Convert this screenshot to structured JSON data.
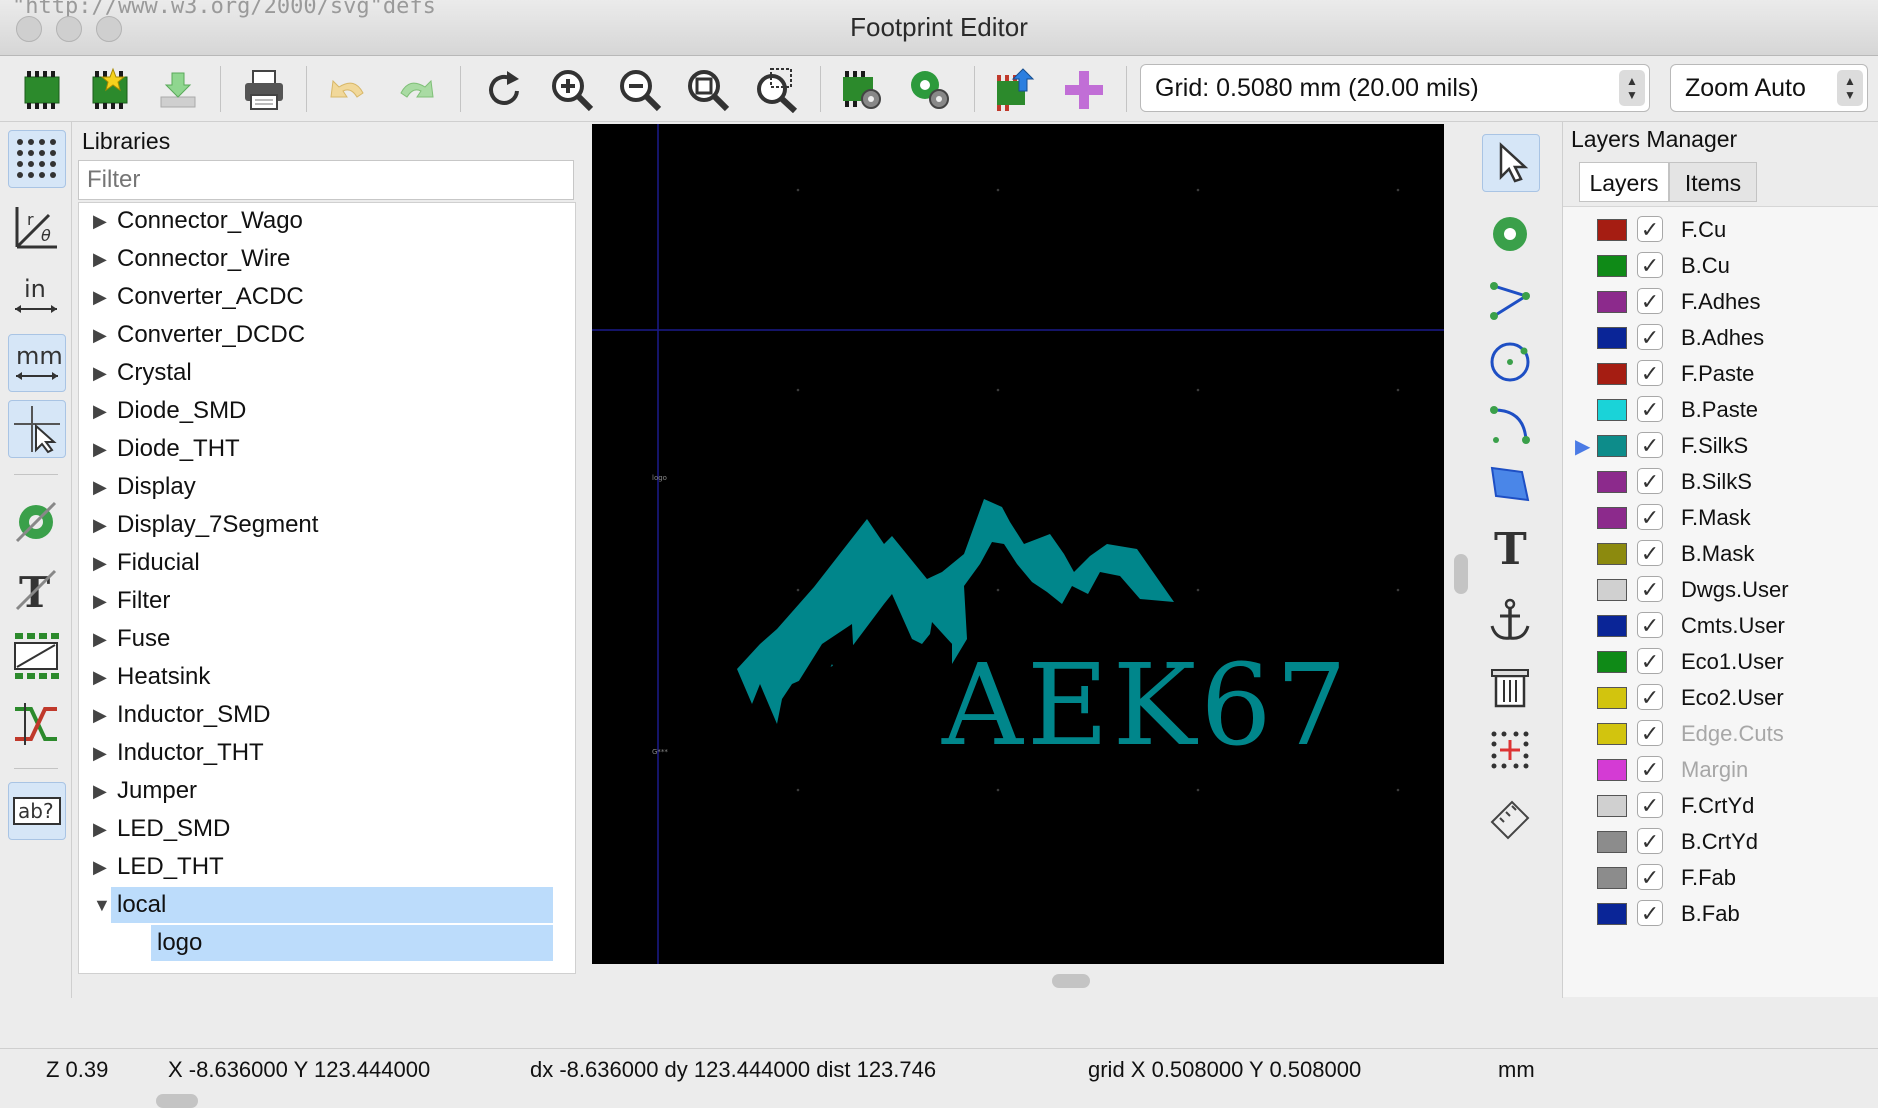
{
  "window": {
    "title": "Footprint Editor",
    "background_url_fragment": "\"http://www.w3.org/2000/svg\"defs"
  },
  "toolbar": {
    "icons": [
      "new-footprint-icon",
      "new-footprint-wizard-icon",
      "load-footprint-icon",
      "print-icon",
      "undo-icon",
      "redo-icon",
      "redraw-icon",
      "zoom-in-icon",
      "zoom-out-icon",
      "zoom-fit-icon",
      "zoom-selection-icon",
      "footprint-properties-icon",
      "pad-settings-icon",
      "export-to-board-icon",
      "insert-footprint-icon"
    ],
    "grid_select": "Grid: 0.5080 mm (20.00 mils)",
    "zoom_select": "Zoom Auto"
  },
  "left_tools": {
    "inch_label": "in",
    "mm_label": "mm",
    "abc_label": "ab?"
  },
  "libraries": {
    "title": "Libraries",
    "filter_placeholder": "Filter",
    "items": [
      {
        "label": "Connector_Wago",
        "expanded": false
      },
      {
        "label": "Connector_Wire",
        "expanded": false
      },
      {
        "label": "Converter_ACDC",
        "expanded": false
      },
      {
        "label": "Converter_DCDC",
        "expanded": false
      },
      {
        "label": "Crystal",
        "expanded": false
      },
      {
        "label": "Diode_SMD",
        "expanded": false
      },
      {
        "label": "Diode_THT",
        "expanded": false
      },
      {
        "label": "Display",
        "expanded": false
      },
      {
        "label": "Display_7Segment",
        "expanded": false
      },
      {
        "label": "Fiducial",
        "expanded": false
      },
      {
        "label": "Filter",
        "expanded": false
      },
      {
        "label": "Fuse",
        "expanded": false
      },
      {
        "label": "Heatsink",
        "expanded": false
      },
      {
        "label": "Inductor_SMD",
        "expanded": false
      },
      {
        "label": "Inductor_THT",
        "expanded": false
      },
      {
        "label": "Jumper",
        "expanded": false
      },
      {
        "label": "LED_SMD",
        "expanded": false
      },
      {
        "label": "LED_THT",
        "expanded": false
      },
      {
        "label": "local",
        "expanded": true,
        "selected": true
      }
    ],
    "child": {
      "label": "logo",
      "selected": true
    }
  },
  "canvas": {
    "logo_text": "AEK67",
    "logo_color": "#00868b",
    "ref_label": "logo",
    "value_label": "G***"
  },
  "layers_manager": {
    "title": "Layers Manager",
    "tabs": [
      "Layers",
      "Items"
    ],
    "active_tab": "Layers",
    "active_layer": "F.SilkS",
    "layers": [
      {
        "name": "F.Cu",
        "color": "#a51d12",
        "checked": true,
        "dim": false
      },
      {
        "name": "B.Cu",
        "color": "#0f8a17",
        "checked": true,
        "dim": false
      },
      {
        "name": "F.Adhes",
        "color": "#8c2a8c",
        "checked": true,
        "dim": false
      },
      {
        "name": "B.Adhes",
        "color": "#0a2597",
        "checked": true,
        "dim": false
      },
      {
        "name": "F.Paste",
        "color": "#a51d12",
        "checked": true,
        "dim": false
      },
      {
        "name": "B.Paste",
        "color": "#1ad3d8",
        "checked": true,
        "dim": false
      },
      {
        "name": "F.SilkS",
        "color": "#0d8c8a",
        "checked": true,
        "dim": false
      },
      {
        "name": "B.SilkS",
        "color": "#8c2a8c",
        "checked": true,
        "dim": false
      },
      {
        "name": "F.Mask",
        "color": "#8c2a8c",
        "checked": true,
        "dim": false
      },
      {
        "name": "B.Mask",
        "color": "#8c8a0e",
        "checked": true,
        "dim": false
      },
      {
        "name": "Dwgs.User",
        "color": "#d0d0d0",
        "checked": true,
        "dim": false
      },
      {
        "name": "Cmts.User",
        "color": "#0a2597",
        "checked": true,
        "dim": false
      },
      {
        "name": "Eco1.User",
        "color": "#0f8a17",
        "checked": true,
        "dim": false
      },
      {
        "name": "Eco2.User",
        "color": "#d2c40e",
        "checked": true,
        "dim": false
      },
      {
        "name": "Edge.Cuts",
        "color": "#d2c40e",
        "checked": true,
        "dim": true
      },
      {
        "name": "Margin",
        "color": "#d43bd4",
        "checked": true,
        "dim": true
      },
      {
        "name": "F.CrtYd",
        "color": "#d0d0d0",
        "checked": true,
        "dim": false
      },
      {
        "name": "B.CrtYd",
        "color": "#8c8c8c",
        "checked": true,
        "dim": false
      },
      {
        "name": "F.Fab",
        "color": "#8c8c8c",
        "checked": true,
        "dim": false
      },
      {
        "name": "B.Fab",
        "color": "#0a2597",
        "checked": true,
        "dim": false
      }
    ]
  },
  "status": {
    "zoom": "Z 0.39",
    "xy": "X -8.636000  Y 123.444000",
    "delta": "dx -8.636000  dy 123.444000  dist 123.746",
    "grid": "grid X 0.508000  Y 0.508000",
    "units": "mm"
  }
}
